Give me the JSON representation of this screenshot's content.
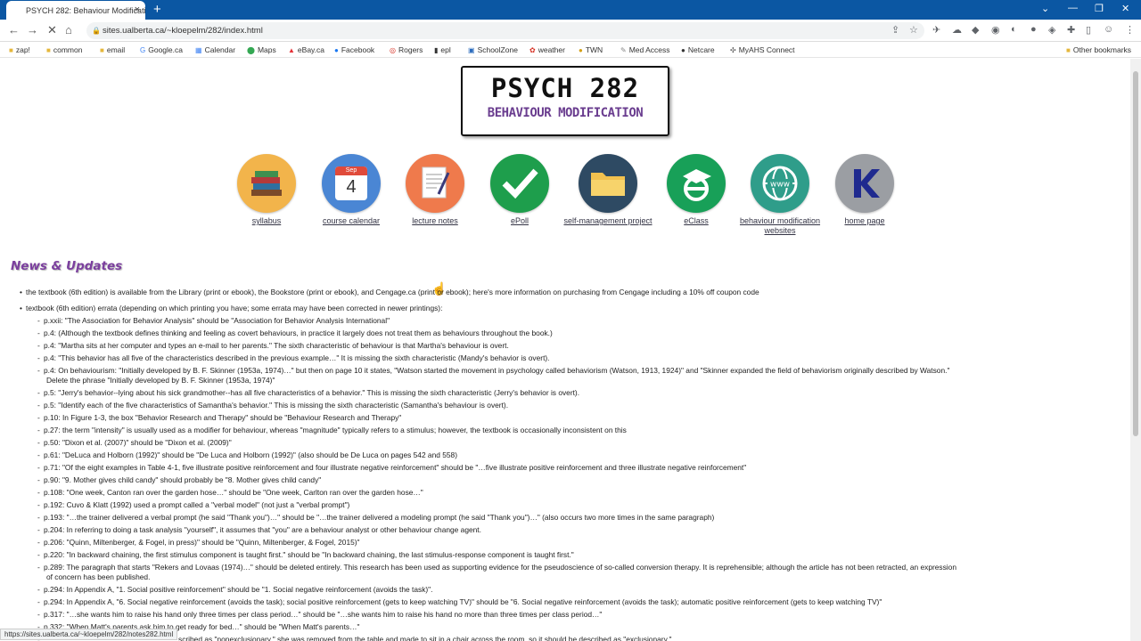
{
  "tab": {
    "title": "PSYCH 282: Behaviour Modificatio",
    "close": "×",
    "new": "+"
  },
  "window": {
    "minimize": "⌄",
    "min": "—",
    "restore": "❐",
    "close": "✕"
  },
  "toolbar": {
    "url": "sites.ualberta.ca/~kloepelm/282/index.html"
  },
  "bookmarks": [
    "zap!",
    "common",
    "email",
    "Google.ca",
    "Calendar",
    "Maps",
    "eBay.ca",
    "Facebook",
    "Rogers",
    "epl",
    "SchoolZone",
    "weather",
    "TWN",
    "Med Access",
    "Netcare",
    "MyAHS Connect"
  ],
  "other_bookmarks": "Other bookmarks",
  "logo": {
    "line1": "PSYCH 282",
    "line2": "BEHAVIOUR MODIFICATION"
  },
  "icons": [
    {
      "label": "syllabus",
      "color": "#f2b44b"
    },
    {
      "label": "course calendar",
      "color": "#4a86d4",
      "month": "Sep",
      "day": "4"
    },
    {
      "label": "lecture notes",
      "color": "#ef7a4c"
    },
    {
      "label": "ePoll",
      "color": "#1e9e4c"
    },
    {
      "label": "self-management project",
      "color": "#2e4a63"
    },
    {
      "label": "eClass",
      "color": "#18a058"
    },
    {
      "label": "behaviour modification websites",
      "color": "#2f9d8a"
    },
    {
      "label": "home page",
      "color": "#9b9ea3"
    }
  ],
  "news_title": "News & Updates",
  "items": [
    "the textbook (6th edition) is available from the Library (print or ebook), the Bookstore (print or ebook), and Cengage.ca (print or ebook); here's more information on purchasing from Cengage including a 10% off coupon code",
    "textbook (6th edition) errata (depending on which printing you have; some errata may have been corrected in newer printings):"
  ],
  "errata": [
    "p.xxii: \"The Association for Behavior Analysis\" should be \"Association for Behavior Analysis International\"",
    "p.4: (Although the textbook defines thinking and feeling as covert behaviours, in practice it largely does not treat them as behaviours throughout the book.)",
    "p.4: \"Martha sits at her computer and types an e-mail to her parents.\" The sixth characteristic of behaviour is that Martha's behaviour is overt.",
    "p.4: \"This behavior has all five of the characteristics described in the previous example…\" It is missing the sixth characteristic (Mandy's behavior is overt).",
    "p.4: On behaviourism: \"Initially developed by B. F. Skinner (1953a, 1974)…\" but then on page 10 it states, \"Watson started the movement in psychology called behaviorism (Watson, 1913, 1924)\" and \"Skinner expanded the field of behaviorism originally described by Watson.\"",
    "Delete the phrase \"Initially developed by B. F. Skinner (1953a, 1974)\"",
    "p.5: \"Jerry's behavior--lying about his sick grandmother--has all five characteristics of a behavior.\" This is missing the sixth characteristic (Jerry's behavior is overt).",
    "p.5: \"Identify each of the five characteristics of Samantha's behavior.\" This is missing the sixth characteristic (Samantha's behaviour is overt).",
    "p.10: In Figure 1-3, the box \"Behavior Research and Therapy\" should be \"Behaviour Research and Therapy\"",
    "p.27: the term \"intensity\" is usually used as a modifier for behaviour, whereas \"magnitude\" typically refers to a stimulus; however, the textbook is occasionally inconsistent on this",
    "p.50: \"Dixon et al. (2007)\" should be \"Dixon et al. (2009)\"",
    "p.61: \"DeLuca and Holborn (1992)\" should be \"De Luca and Holborn (1992)\" (also should be De Luca on pages 542 and 558)",
    "p.71: \"Of the eight examples in Table 4-1, five illustrate positive reinforcement and four illustrate negative reinforcement\" should be \"…five illustrate positive reinforcement and three illustrate negative reinforcement\"",
    "p.90: \"9. Mother gives child candy\" should probably be \"8. Mother gives child candy\"",
    "p.108: \"One week, Canton ran over the garden hose…\" should be \"One week, Carlton ran over the garden hose…\"",
    "p.192: Cuvo & Klatt (1992) used a prompt called a \"verbal model\" (not just a \"verbal prompt\")",
    "p.193: \"…the trainer delivered a verbal prompt (he said \"Thank you\")…\" should be \"…the trainer delivered a modeling prompt (he said \"Thank you\")…\" (also occurs two more times in the same paragraph)",
    "p.204: In referring to doing a task analysis \"yourself\", it assumes that \"you\" are a behaviour analyst or other behaviour change agent.",
    "p.206: \"Quinn, Miltenberger, & Fogel, in press)\" should be \"Quinn, Miltenberger, & Fogel, 2015)\"",
    "p.220: \"In backward chaining, the first stimulus component is taught first.\" should be \"In backward chaining, the last stimulus-response component is taught first.\"",
    "p.289: The paragraph that starts \"Rekers and Lovaas (1974)…\" should be deleted entirely. This research has been used as supporting evidence for the pseudoscience of so-called conversion therapy. It is reprehensible; although the article has not been retracted, an expression",
    "of concern has been published.",
    "p.294: In Appendix A, \"1. Social positive reinforcement\" should be \"1. Social negative reinforcement (avoids the task)\".",
    "p.294: In Appendix A, \"6. Social negative reinforcement (avoids the task); social positive reinforcement (gets to keep watching TV)\" should be \"6. Social negative reinforcement (avoids the task); automatic positive reinforcement (gets to keep watching TV)\"",
    "p.317: \"…she wants him to raise his hand only three times per class period…\" should be \"…she wants him to raise his hand no more than three times per class period…\"",
    "p.332: \"When Matt's parents ask him to get ready for bed…\" should be \"When Matt's parents…\"",
    "scribed as \"nonexclusionary,\" she was removed from the table and made to sit in a chair across the room, so it should be described as \"exclusionary.\""
  ],
  "status_url": "https://sites.ualberta.ca/~kloepelm/282/notes282.html"
}
